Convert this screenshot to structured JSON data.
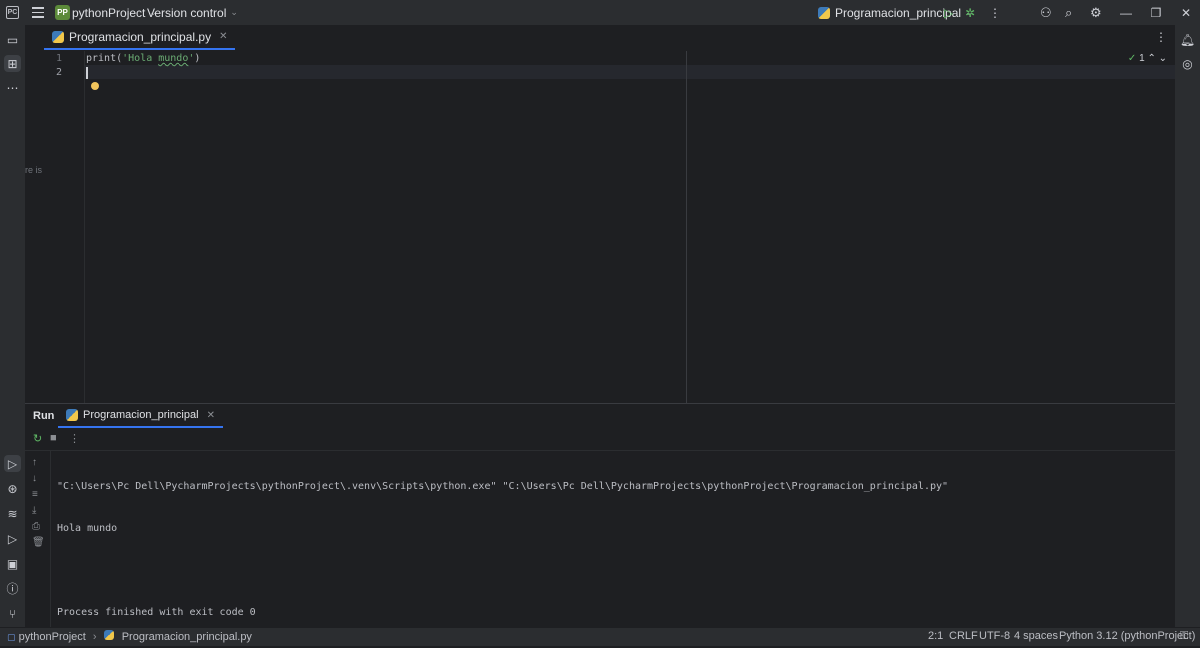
{
  "titlebar": {
    "project_badge": "PP",
    "project_name": "pythonProject",
    "version_control": "Version control",
    "run_config": "Programacion_principal"
  },
  "editor": {
    "tab_label": "Programacion_principal.py",
    "line_numbers": [
      "1",
      "2"
    ],
    "code_line1_fn": "print(",
    "code_line1_q1": "'Hola ",
    "code_line1_word": "mundo",
    "code_line1_q2": "'",
    "code_line1_end": ")",
    "inspection_count": "1",
    "cut_text": "re is"
  },
  "run_panel": {
    "title": "Run",
    "tab_label": "Programacion_principal",
    "console_lines": [
      "\"C:\\Users\\Pc Dell\\PycharmProjects\\pythonProject\\.venv\\Scripts\\python.exe\" \"C:\\Users\\Pc Dell\\PycharmProjects\\pythonProject\\Programacion_principal.py\"",
      "Hola mundo",
      "",
      "Process finished with exit code 0"
    ]
  },
  "statusbar": {
    "project": "pythonProject",
    "file": "Programacion_principal.py",
    "position": "2:1",
    "line_sep": "CRLF",
    "encoding": "UTF-8",
    "indent": "4 spaces",
    "interpreter": "Python 3.12 (pythonProject)"
  }
}
